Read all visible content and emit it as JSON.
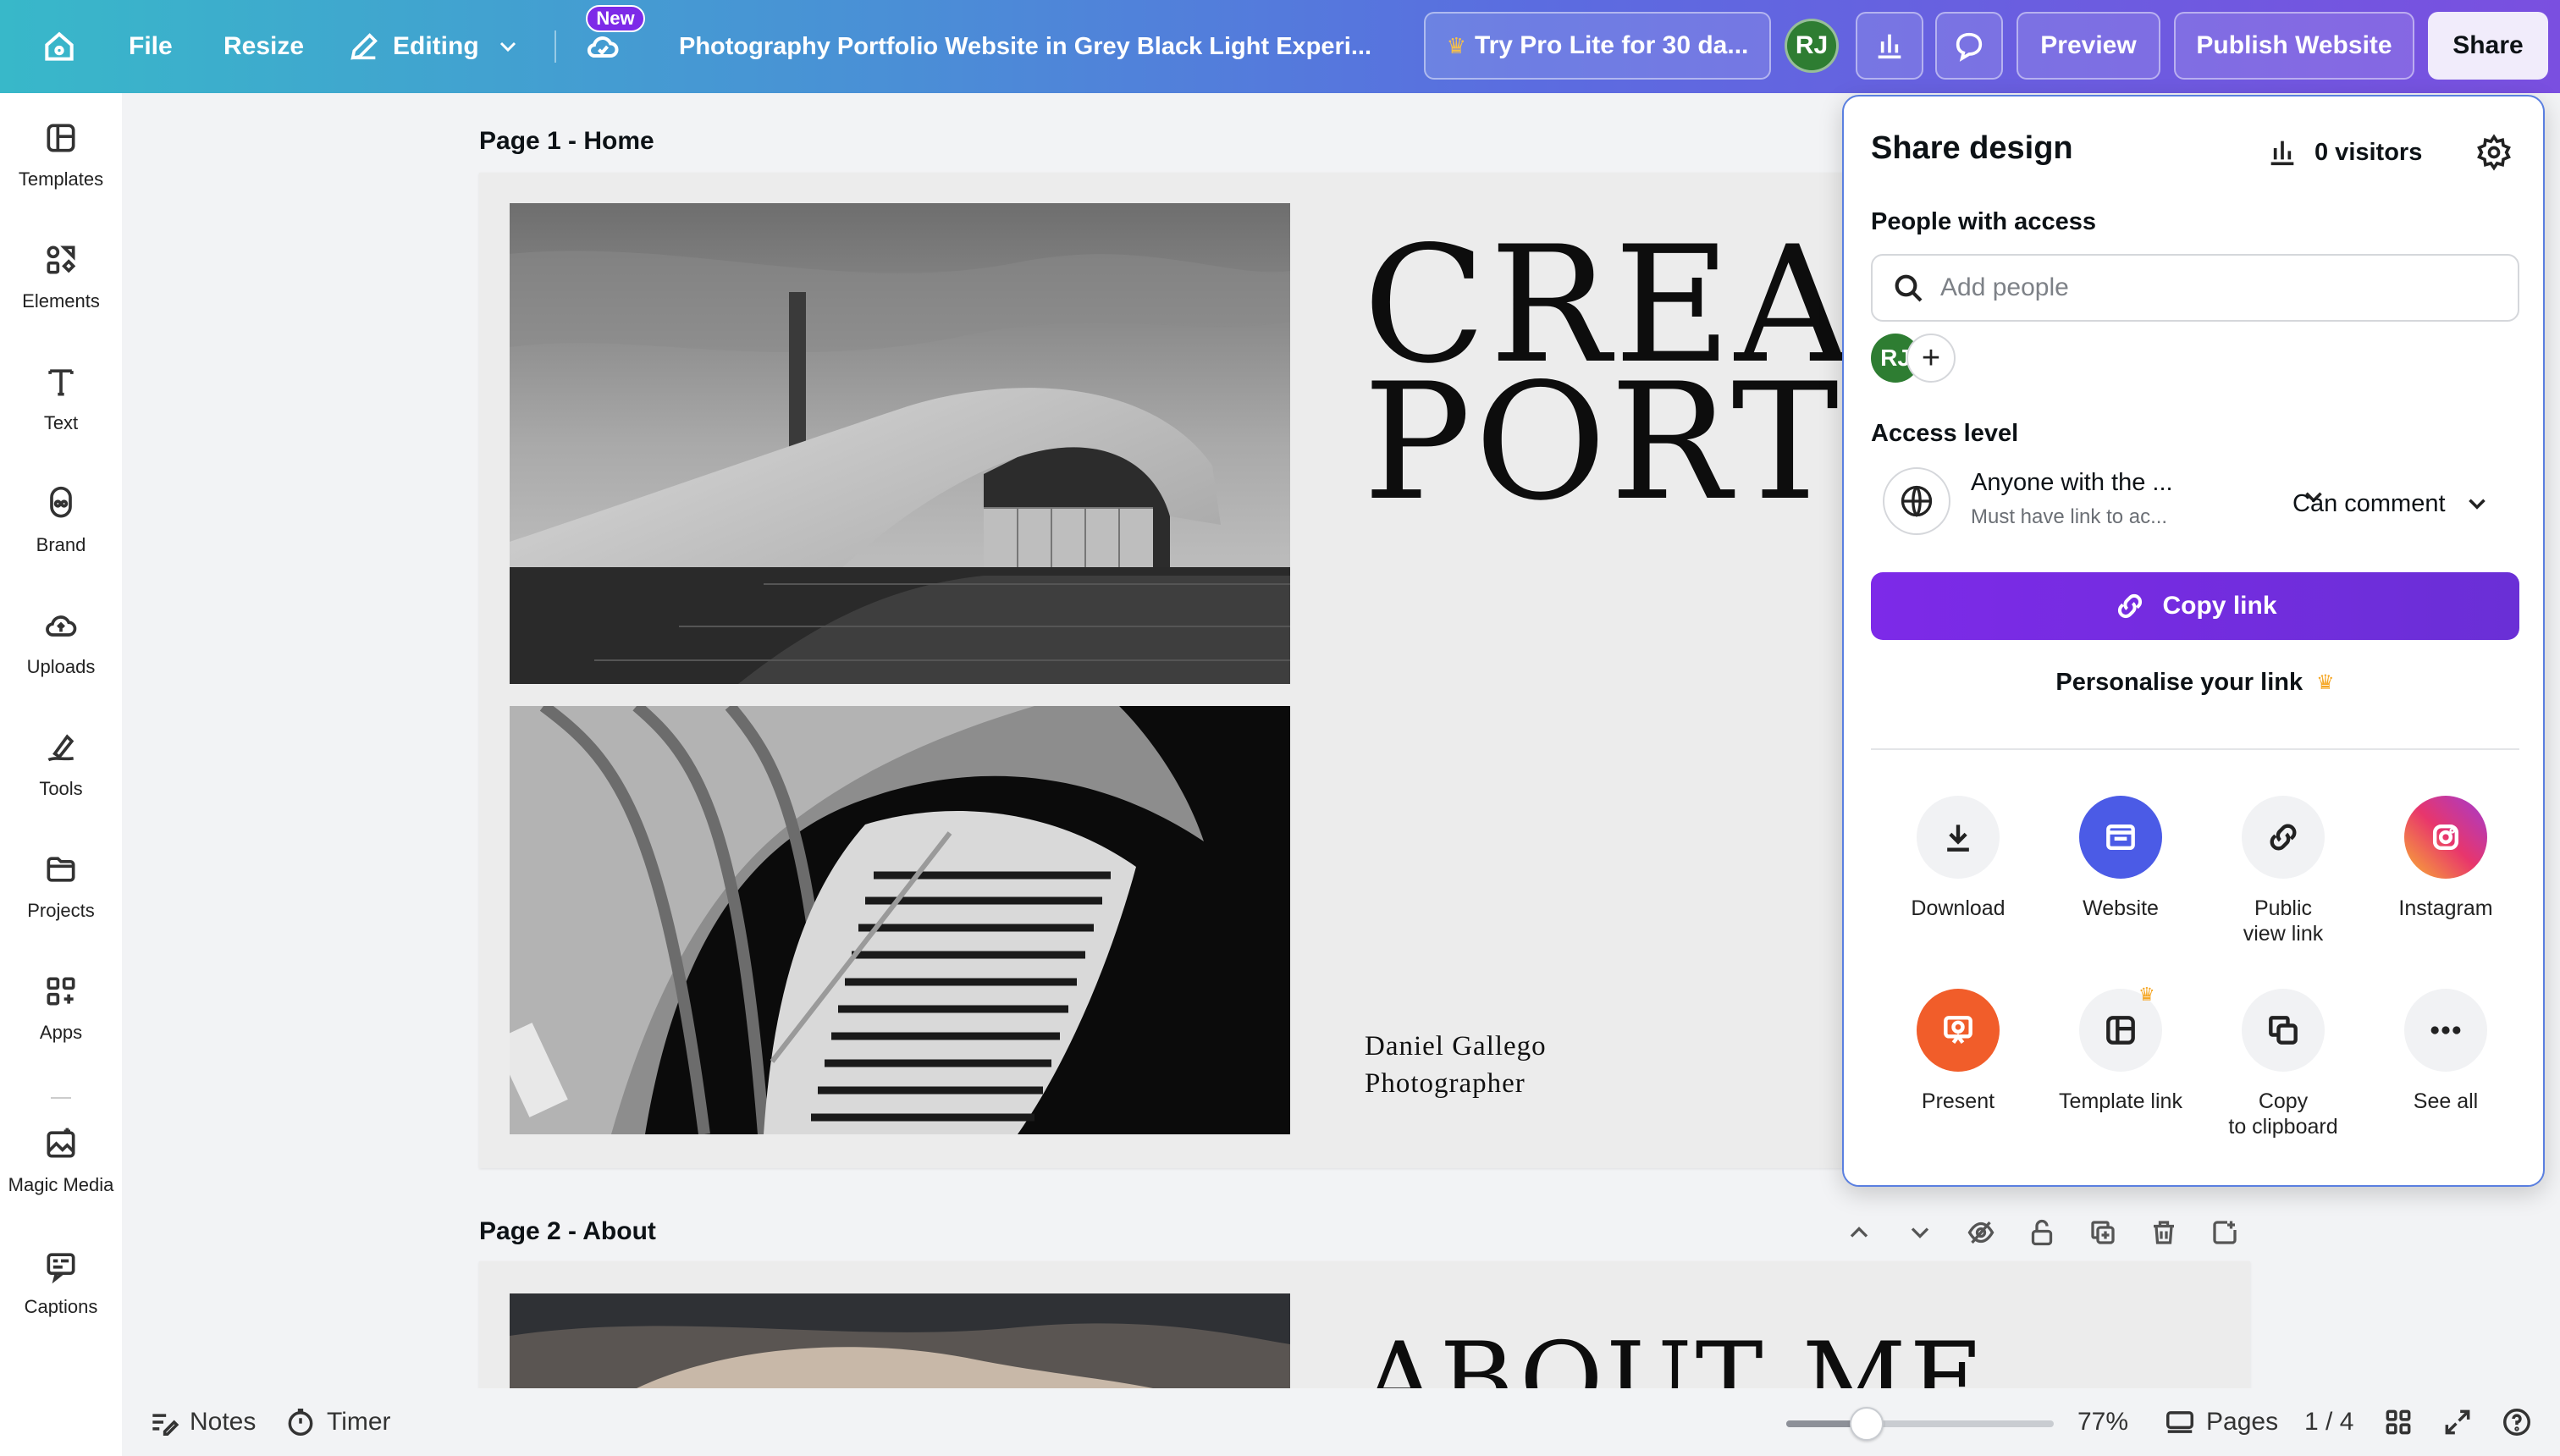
{
  "topbar": {
    "file": "File",
    "resize": "Resize",
    "editing": "Editing",
    "new_badge": "New",
    "doc_title": "Photography Portfolio Website in Grey  Black  Light Experi...",
    "pro_trial": "Try Pro Lite for 30 da...",
    "avatar_initials": "RJ",
    "preview": "Preview",
    "publish": "Publish Website",
    "share": "Share"
  },
  "sidebar": {
    "items": [
      {
        "label": "Templates",
        "icon": "templates-icon"
      },
      {
        "label": "Elements",
        "icon": "elements-icon"
      },
      {
        "label": "Text",
        "icon": "text-icon"
      },
      {
        "label": "Brand",
        "icon": "brand-icon"
      },
      {
        "label": "Uploads",
        "icon": "upload-cloud-icon"
      },
      {
        "label": "Tools",
        "icon": "draw-tool-icon"
      },
      {
        "label": "Projects",
        "icon": "folder-icon"
      },
      {
        "label": "Apps",
        "icon": "apps-icon"
      },
      {
        "label": "Magic Media",
        "icon": "magic-media-icon"
      },
      {
        "label": "Captions",
        "icon": "captions-icon"
      }
    ]
  },
  "canvas": {
    "page1_label": "Page 1 - Home",
    "page2_label": "Page 2 - About",
    "hero_line1": "CREAT",
    "hero_line2": "PORTF",
    "credit_name": "Daniel Gallego",
    "credit_role": "Photographer",
    "page2_heading": "ABOUT ME"
  },
  "share_panel": {
    "title": "Share design",
    "visitors": "0 visitors",
    "people_heading": "People with access",
    "add_people_placeholder": "Add people",
    "avatar_initials": "RJ",
    "access_heading": "Access level",
    "access_main": "Anyone with the ...",
    "access_sub": "Must have link to ac...",
    "permission": "Can comment",
    "copy_link": "Copy link",
    "personalise": "Personalise your link",
    "options": [
      {
        "label": "Download",
        "icon": "download-icon"
      },
      {
        "label": "Website",
        "icon": "website-icon"
      },
      {
        "label": "Public\nview link",
        "icon": "link-icon"
      },
      {
        "label": "Instagram",
        "icon": "instagram-icon"
      },
      {
        "label": "Present",
        "icon": "present-icon"
      },
      {
        "label": "Template link",
        "icon": "template-link-icon"
      },
      {
        "label": "Copy\nto clipboard",
        "icon": "copy-icon"
      },
      {
        "label": "See all",
        "icon": "more-icon"
      }
    ]
  },
  "bottombar": {
    "notes": "Notes",
    "timer": "Timer",
    "zoom": "77%",
    "zoom_fraction": 0.3,
    "pages": "Pages",
    "page_counter": "1 / 4"
  },
  "colors": {
    "accent_purple": "#7d2ae8",
    "pro_crown": "#f5a623",
    "avatar_green": "#2e7d32"
  }
}
